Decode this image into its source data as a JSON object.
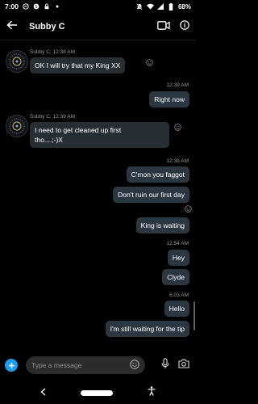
{
  "status_bar": {
    "time": "7:00",
    "battery": "68%"
  },
  "header": {
    "contact_name": "Subby C"
  },
  "messages": [
    {
      "sender": "Subby C, 12:38 AM",
      "text": "OK I will try that my King XX"
    },
    {
      "time": "12:39 AM",
      "text": "Right now"
    },
    {
      "sender": "Subby C, 12:39 AM",
      "line1": "I need to get cleaned up first",
      "line2": "tho....;-)X"
    },
    {
      "time": "12:39 AM"
    },
    {
      "text": "C'mon you faggot"
    },
    {
      "text": "Don't ruin our first day"
    },
    {
      "text": "King is waiting"
    },
    {
      "time": "12:54 AM",
      "text": "Hey"
    },
    {
      "text": "Clyde"
    },
    {
      "time": "6:03 AM",
      "text": "Hello"
    },
    {
      "text": "I'm still waiting for the tip"
    }
  ],
  "composer": {
    "placeholder": "Type a message"
  },
  "colors": {
    "accent": "#1d9bf0",
    "incoming_bubble": "#262d33",
    "outgoing_bubble": "#2a3740",
    "background": "#000000"
  },
  "icons": [
    "back-arrow-icon",
    "video-call-icon",
    "info-icon",
    "emoji-reaction-icon",
    "add-icon",
    "emoji-icon",
    "microphone-icon",
    "camera-icon",
    "nav-back-icon",
    "accessibility-icon"
  ]
}
